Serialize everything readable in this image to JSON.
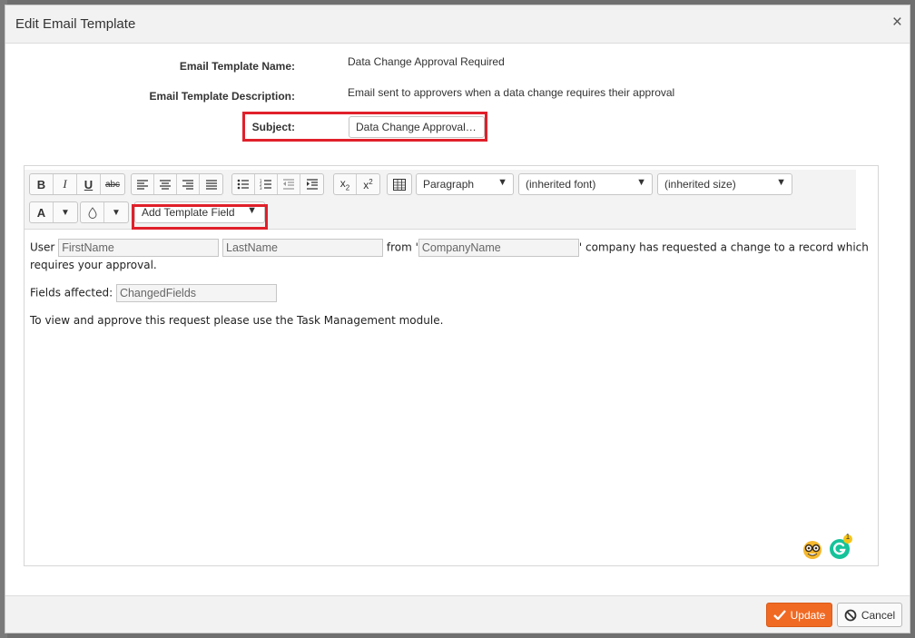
{
  "dialog": {
    "title": "Edit Email Template",
    "close_glyph": "×"
  },
  "form": {
    "name_label": "Email Template Name:",
    "name_value": "Data Change Approval Required",
    "description_label": "Email Template Description:",
    "description_value": "Email sent to approvers when a data change requires their approval",
    "subject_label": "Subject:",
    "subject_value": "Data Change Approval Required"
  },
  "toolbar": {
    "bold": "B",
    "italic": "I",
    "underline": "U",
    "strike": "abc",
    "paragraph_select": "Paragraph",
    "font_select": "(inherited font)",
    "size_select": "(inherited size)",
    "font_color": "A",
    "add_template_field": "Add Template Field",
    "caret": "▼"
  },
  "content": {
    "line1_user": "User",
    "field_first": "FirstName",
    "field_last": "LastName",
    "line1_from": "from '",
    "field_company": "CompanyName",
    "line1_tail": "' company has requested a change to a record which requires your approval.",
    "line2_label": "Fields affected:",
    "field_changed": "ChangedFields",
    "line3": "To view and approve this request please use the Task Management module."
  },
  "grammarly_badge": "1",
  "footer": {
    "update_label": "Update",
    "cancel_label": "Cancel"
  },
  "colors": {
    "accent": "#f06a24",
    "highlight": "#e0202a",
    "grammarly": "#15c39a"
  }
}
